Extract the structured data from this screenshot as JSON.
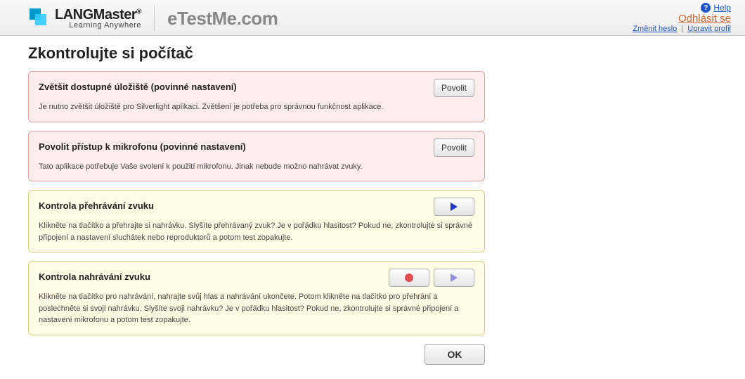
{
  "header": {
    "logo_main": "LANGMaster",
    "logo_reg": "®",
    "logo_sub": "Learning Anywhere",
    "brand": "eTestMe.com",
    "help": "Help",
    "logout": "Odhlásit se",
    "change_password": "Změnit heslo",
    "edit_profile": "Upravit profil",
    "sep": "|"
  },
  "page": {
    "title": "Zkontrolujte si počítač",
    "ok": "OK"
  },
  "panels": {
    "storage": {
      "title": "Zvětšit dostupné úložiště (povinné nastavení)",
      "body": "Je nutno zvětšit úložiště pro Silverlight aplikaci. Zvětšení je potřeba pro správnou funkčnost aplikace.",
      "button": "Povolit"
    },
    "mic": {
      "title": "Povolit přístup k mikrofonu (povinné nastavení)",
      "body": "Tato aplikace potřebuje Vaše svolení k použití mikrofonu. Jinak nebude možno nahrávat zvuky.",
      "button": "Povolit"
    },
    "playback": {
      "title": "Kontrola přehrávání zvuku",
      "body": "Klikněte na tlačítko a přehrajte si nahrávku. Slyšíte přehrávaný zvuk? Je v pořádku hlasitost? Pokud ne, zkontrolujte si správné připojení a nastavení sluchátek nebo reproduktorů a potom test zopakujte."
    },
    "recording": {
      "title": "Kontrola nahrávání zvuku",
      "body": "Klikněte na tlačítko pro nahrávání, nahrajte svůj hlas a nahrávání ukončete. Potom klikněte na tlačítko pro přehrání a poslechněte si svoji nahrávku. Slyšíte svoji nahrávku? Je v pořádku hlasitost? Pokud ne, zkontrolujte si správné připojení a nastavení mikrofonu a potom test zopakujte."
    }
  }
}
